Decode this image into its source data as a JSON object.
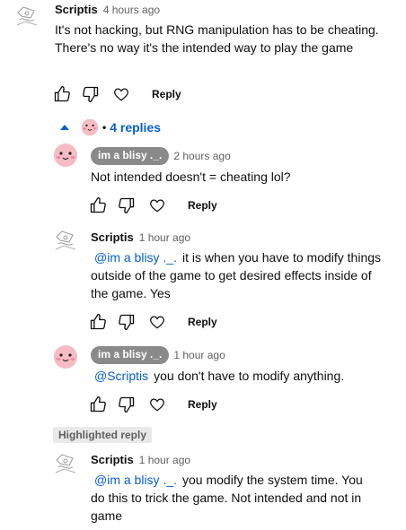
{
  "comments": [
    {
      "author": "Scriptis",
      "time": "4 hours ago",
      "text": "It's not hacking, but RNG manipulation has to be cheating. There's no way it's the intended way to play the game",
      "reply_label": "Reply"
    },
    {
      "author": "im a blisy ._.",
      "time": "2 hours ago",
      "text": "Not intended doesn't = cheating lol?",
      "reply_label": "Reply"
    },
    {
      "author": "Scriptis",
      "time": "1 hour ago",
      "mention": "@im a blisy ._.",
      "text": "it is when you have to modify things outside of the game to get desired effects inside of the game. Yes",
      "reply_label": "Reply"
    },
    {
      "author": "im a blisy ._.",
      "time": "1 hour ago",
      "mention": "@Scriptis",
      "text": "you don't have to modify anything.",
      "reply_label": "Reply"
    },
    {
      "author": "Scriptis",
      "time": "1 hour ago",
      "mention": "@im a blisy ._.",
      "text": "you modify the system time. You do this to trick the game. Not intended and not in game"
    }
  ],
  "replies_toggle": {
    "count_label": "4 replies",
    "icon": "caret-up-icon"
  },
  "highlighted_label": "Highlighted reply",
  "colors": {
    "link": "#065fd4",
    "pill": "#8a8a8a",
    "text": "#0f0f0f",
    "muted": "#606060"
  }
}
